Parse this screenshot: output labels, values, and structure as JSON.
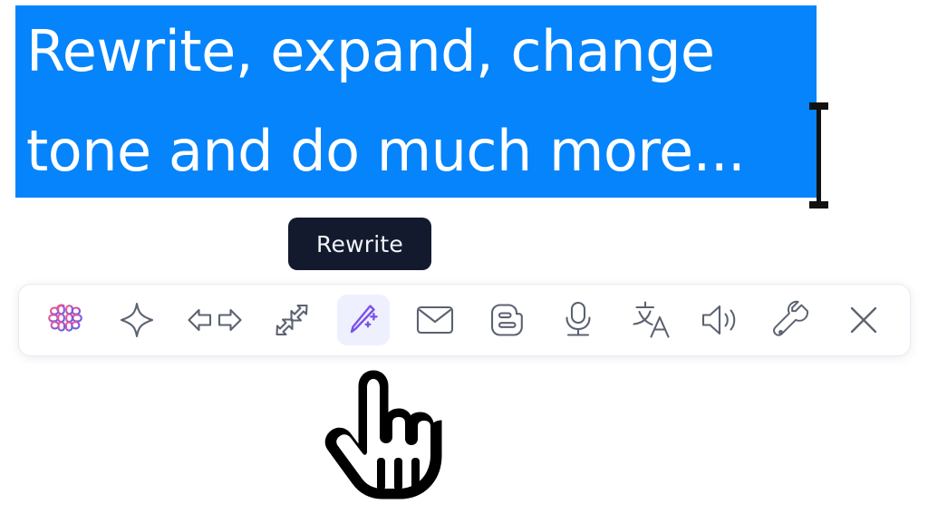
{
  "selection": {
    "lines": [
      "Rewrite, expand, change",
      "tone and do much more..."
    ],
    "highlight_color": "#0584FB",
    "text_color": "#FFFFFF"
  },
  "caret": {
    "name": "text-cursor",
    "color": "#111111"
  },
  "tooltip": {
    "label": "Rewrite",
    "background_color": "#141A2E",
    "text_color": "#F2F4F8"
  },
  "toolbar": {
    "background_color": "#FFFFFF",
    "border_color": "#E9EAF2",
    "active_item_background": "#EEF0FD",
    "icon_color": "#5B6270",
    "items": [
      {
        "name": "brain-logo-icon",
        "label": "Assistant",
        "active": false,
        "interactable": true
      },
      {
        "name": "sparkle-icon",
        "label": "Improve",
        "active": false,
        "interactable": true
      },
      {
        "name": "arrows-lr-icon",
        "label": "Shorten",
        "active": false,
        "interactable": true
      },
      {
        "name": "expand-arrows-icon",
        "label": "Expand",
        "active": false,
        "interactable": true
      },
      {
        "name": "magic-wand-icon",
        "label": "Rewrite",
        "active": true,
        "interactable": true
      },
      {
        "name": "envelope-icon",
        "label": "Email",
        "active": false,
        "interactable": true
      },
      {
        "name": "blogger-icon",
        "label": "Blog",
        "active": false,
        "interactable": true
      },
      {
        "name": "microphone-icon",
        "label": "Dictate",
        "active": false,
        "interactable": true
      },
      {
        "name": "translate-icon",
        "label": "Translate",
        "active": false,
        "interactable": true
      },
      {
        "name": "speaker-icon",
        "label": "Read aloud",
        "active": false,
        "interactable": true
      },
      {
        "name": "wrench-icon",
        "label": "Settings",
        "active": false,
        "interactable": true
      },
      {
        "name": "close-icon",
        "label": "Close",
        "active": false,
        "interactable": true
      }
    ]
  },
  "cursor": {
    "name": "pointing-hand-cursor",
    "color": "#000000"
  }
}
